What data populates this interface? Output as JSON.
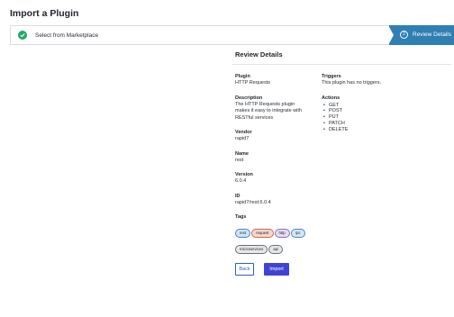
{
  "page": {
    "title": "Import a Plugin"
  },
  "stepper": {
    "step1": {
      "label": "Select from Marketplace",
      "status": "complete"
    },
    "step2": {
      "number": "2",
      "label": "Review Details",
      "status": "active"
    },
    "active_color": "#2f7fb3",
    "complete_color": "#21a86b"
  },
  "review": {
    "title": "Review Details",
    "plugin": {
      "label": "Plugin",
      "value": "HTTP Requests"
    },
    "description": {
      "label": "Description",
      "lines": [
        "The HTTP Requests plugin",
        "makes it easy to integrate with",
        "RESTful services"
      ]
    },
    "vendor": {
      "label": "Vendor",
      "value": "rapid7"
    },
    "name": {
      "label": "Name",
      "value": "rest"
    },
    "version": {
      "label": "Version",
      "value": "6.0.4"
    },
    "id": {
      "label": "ID",
      "value": "rapid7/rest:6.0.4"
    },
    "tags": {
      "label": "Tags",
      "items": [
        {
          "text": "rest",
          "bg": "#cfe3f7",
          "border": "#4a86c5"
        },
        {
          "text": "request",
          "bg": "#f6d6cf",
          "border": "#c86a52"
        },
        {
          "text": "http",
          "bg": "#e6dcf5",
          "border": "#8a6fc0"
        },
        {
          "text": "rpc",
          "bg": "#d5e6f5",
          "border": "#4a86c5"
        },
        {
          "text": "microservices",
          "bg": "#e7e7e7",
          "border": "#6b7280"
        },
        {
          "text": "api",
          "bg": "#e7e7e7",
          "border": "#6b7280"
        }
      ]
    },
    "triggers": {
      "label": "Triggers",
      "value": "This plugin has no triggers."
    },
    "actions": {
      "label": "Actions",
      "items": [
        "GET",
        "POST",
        "PUT",
        "PATCH",
        "DELETE"
      ]
    }
  },
  "buttons": {
    "back": "Back",
    "import": "Import"
  }
}
